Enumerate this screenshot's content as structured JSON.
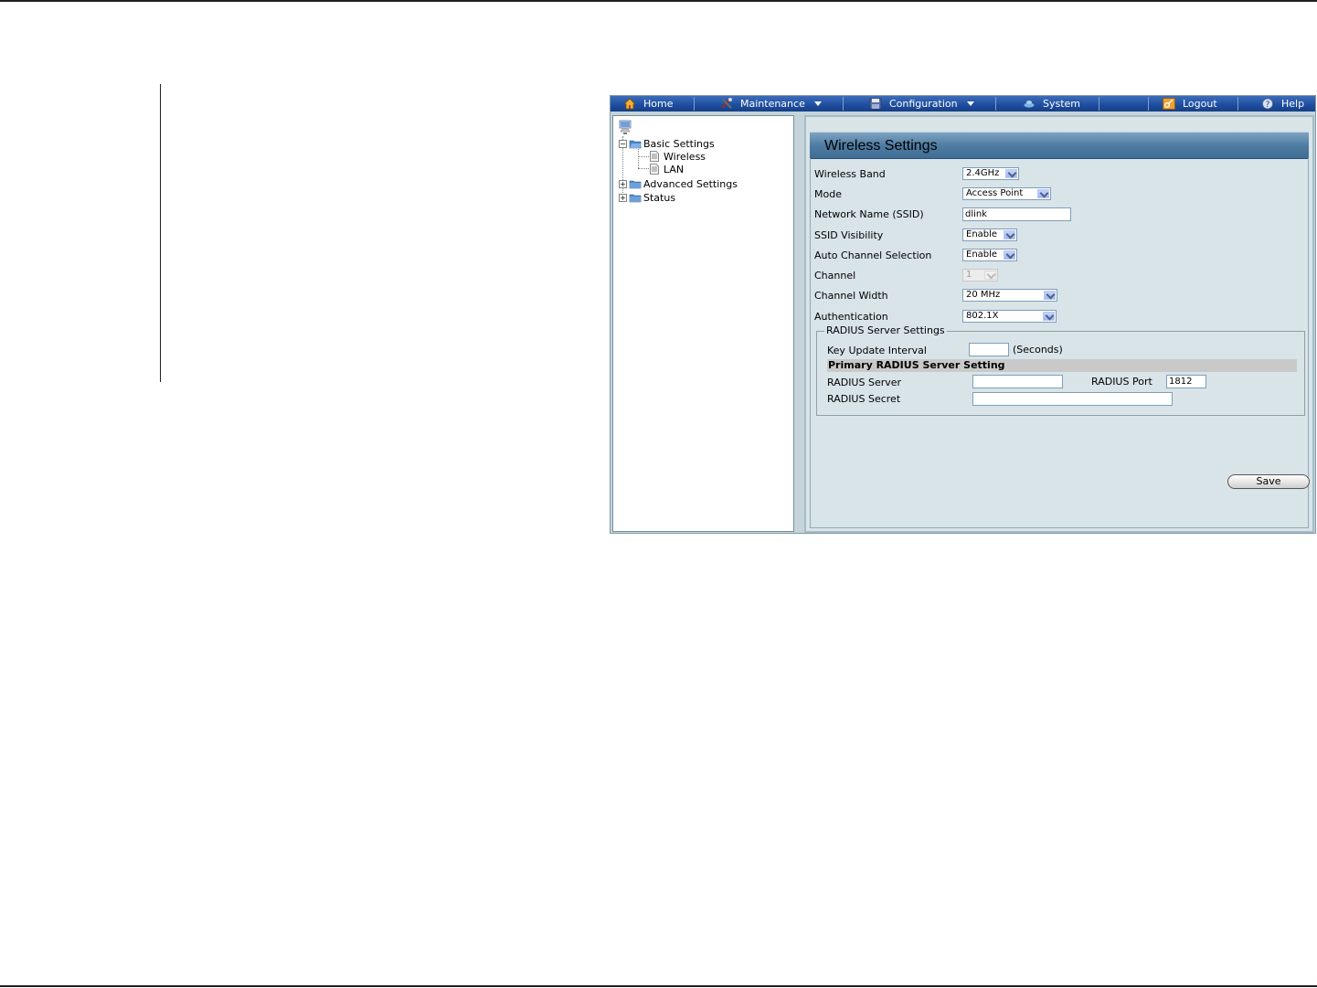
{
  "menubar": {
    "home": "Home",
    "maintenance": "Maintenance",
    "configuration": "Configuration",
    "system": "System",
    "logout": "Logout",
    "help": "Help",
    "color": "#1d4d9e"
  },
  "tree": {
    "basic_settings": "Basic Settings",
    "wireless": "Wireless",
    "lan": "LAN",
    "advanced_settings": "Advanced Settings",
    "status": "Status"
  },
  "panel": {
    "title": "Wireless Settings"
  },
  "form": {
    "wireless_band": {
      "label": "Wireless Band",
      "value": "2.4GHz"
    },
    "mode": {
      "label": "Mode",
      "value": "Access Point"
    },
    "ssid": {
      "label": "Network Name (SSID)",
      "value": "dlink"
    },
    "ssid_visibility": {
      "label": "SSID Visibility",
      "value": "Enable"
    },
    "auto_channel": {
      "label": "Auto Channel Selection",
      "value": "Enable"
    },
    "channel": {
      "label": "Channel",
      "value": "1"
    },
    "channel_width": {
      "label": "Channel Width",
      "value": "20 MHz"
    },
    "authentication": {
      "label": "Authentication",
      "value": "802.1X"
    }
  },
  "radius": {
    "legend": "RADIUS Server Settings",
    "key_update_label": "Key Update Interval",
    "key_update_value": "",
    "key_update_unit": "(Seconds)",
    "primary_heading": "Primary RADIUS Server Setting",
    "server_label": "RADIUS Server",
    "server_value": "",
    "port_label": "RADIUS Port",
    "port_value": "1812",
    "secret_label": "RADIUS Secret",
    "secret_value": ""
  },
  "buttons": {
    "save": "Save"
  }
}
